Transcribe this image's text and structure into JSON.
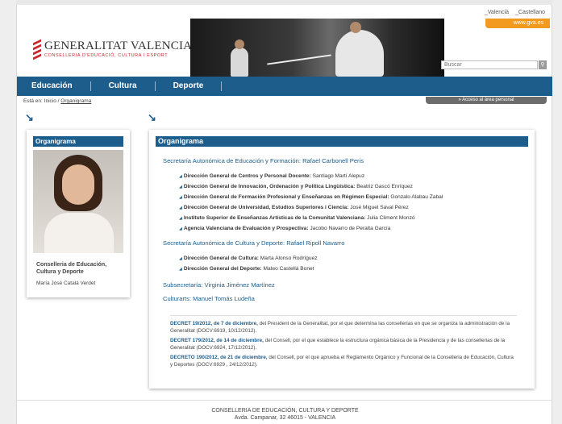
{
  "lang": {
    "valencian": "_Valencià",
    "castilian": "_Castellano"
  },
  "gva_tab": "www.gva.es",
  "logo": {
    "title": "GENERALITAT VALENCIANA",
    "subtitle": "CONSELLERIA D'EDUCACIÓ, CULTURA I ESPORT"
  },
  "search": {
    "placeholder": "Buscar",
    "button_icon": "search-icon"
  },
  "nav": {
    "items": [
      "Educación",
      "Cultura",
      "Deporte"
    ]
  },
  "breadcrumb": {
    "prefix": "Está en:",
    "home": "Inicio",
    "sep": "/",
    "current": "Organigrama"
  },
  "area_personal": "» Acceso al área personal",
  "arrow_glyph": "↘",
  "card": {
    "title": "Organigrama",
    "department": "Conselleria de Educación, Cultura y Deporte",
    "name": "María José Catalá Verdet"
  },
  "panel": {
    "title": "Organigrama",
    "sections": [
      {
        "label": "Secretaría Autonómica de Educación y Formación:",
        "person": "Rafael Carbonell Peris",
        "items": [
          {
            "org": "Dirección General de Centros y Personal Docente:",
            "person": "Santiago Martí Alepuz"
          },
          {
            "org": "Dirección General de Innovación, Ordenación y Política Lingüística:",
            "person": "Beatriz Gascó Enríquez"
          },
          {
            "org": "Dirección General de Formación Profesional y Enseñanzas en Régimen Especial:",
            "person": "Gonzalo Alabau Zabal"
          },
          {
            "org": "Dirección General de Universidad, Estudios Superiores i Ciencia:",
            "person": "José Miguel Saval Pérez"
          },
          {
            "org": "Instituto Superior de Enseñanzas Artísticas de la Comunitat Valenciana:",
            "person": "Julia Climent Monzó"
          },
          {
            "org": "Agencia Valenciana de Evaluación y Prospectiva:",
            "person": "Jacobo Navarro de Peralta García"
          }
        ]
      },
      {
        "label": "Secretaría Autonómica de Cultura y Deporte:",
        "person": "Rafael Ripoll Navarro",
        "items": [
          {
            "org": "Dirección General de Cultura:",
            "person": "Marta Alonso Rodríguez"
          },
          {
            "org": "Dirección General del Deporte:",
            "person": "Mateo Castellá Bonet"
          }
        ]
      }
    ],
    "subsecretaria": {
      "label": "Subsecretaría:",
      "person": "Virginia Jiménez Martínez"
    },
    "culturarts": {
      "label": "Culturarts:",
      "person": "Manuel Tomás Ludeña"
    },
    "decrets": [
      {
        "ref": "DECRET 19/2012, de 7 de diciembre,",
        "text": "del President de la Generalitat, por el que determina las consellerias en que se organiza la administración de la Generalitat (DOCV:6919, 10/12/2012)."
      },
      {
        "ref": "DECRET 179/2012, de 14 de diciembre,",
        "text": "del Consell, por el que establece la estructura orgánica básica de la Presidencia y de las consellerias de la Generalitat (DOCV:6924, 17/12/2012)."
      },
      {
        "ref": "DECRETO 190/2012, de 21 de diciembre,",
        "text": "del Consell, por el que aprueba el Reglamento Orgánico y Funcional de la Conselleria de Educación, Cultura y Deportes (DOCV:6929 , 24/12/2012)."
      }
    ]
  },
  "footer": {
    "line1": "CONSELLERIA DE EDUCACIÓN, CULTURA Y DEPORTE",
    "line2": "Avda. Campanar, 32 46015 - VALENCIA"
  },
  "colors": {
    "brand_blue": "#1d5d8c",
    "accent_orange": "#f29a1f",
    "brand_red": "#c9262a"
  }
}
